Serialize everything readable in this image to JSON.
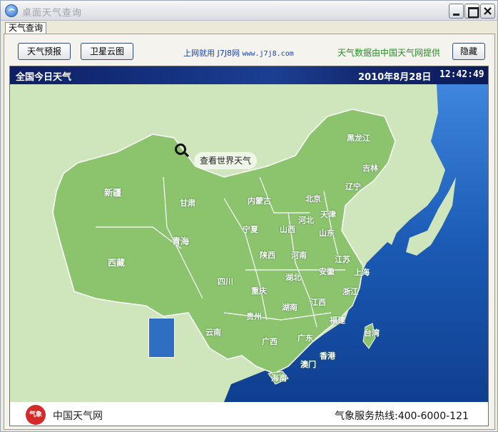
{
  "window": {
    "title": "桌面天气查询"
  },
  "tabs": [
    {
      "label": "天气查询"
    }
  ],
  "toolbar": {
    "forecast_label": "天气预报",
    "satellite_label": "卫星云图",
    "promo_text": "上网就用 J7J8网",
    "promo_site": "www.j7j8.com",
    "provider_text": "天气数据由中国天气网提供",
    "hide_label": "隐藏"
  },
  "map": {
    "header_title": "全国今日天气",
    "date": "2010年8月28日",
    "time": "12:42:49",
    "world_link": "查看世界天气",
    "provinces": [
      "黑龙江",
      "吉林",
      "辽宁",
      "内蒙古",
      "北京",
      "天津",
      "河北",
      "山西",
      "山东",
      "新疆",
      "甘肃",
      "宁夏",
      "青海",
      "西藏",
      "陕西",
      "河南",
      "江苏",
      "上海",
      "安徽",
      "湖北",
      "四川",
      "重庆",
      "浙江",
      "江西",
      "湖南",
      "贵州",
      "福建",
      "台湾",
      "云南",
      "广西",
      "广东",
      "香港",
      "澳门",
      "海南"
    ],
    "footer_name": "中国天气网",
    "hotline": "气象服务热线:400-6000-121"
  },
  "colors": {
    "land": "#8cc46e",
    "sea": "#1b4f9c",
    "foreign_land": "#cfe6bd",
    "header": "#14307e"
  }
}
